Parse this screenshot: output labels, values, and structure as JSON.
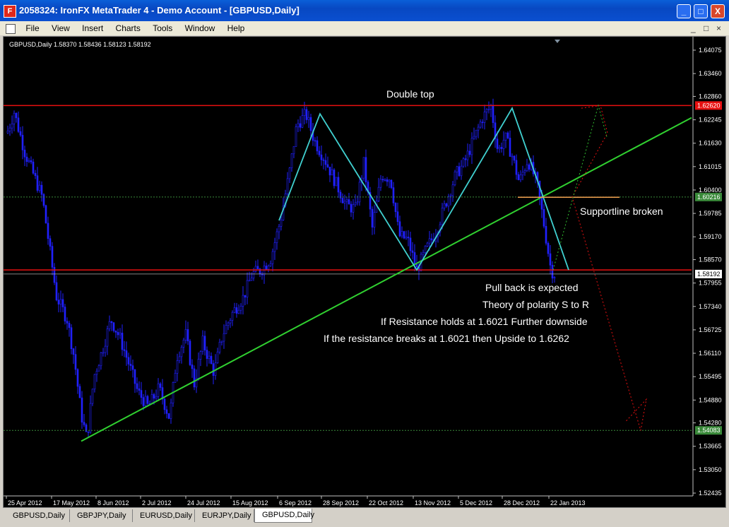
{
  "window": {
    "icon_letter": "F",
    "title": "2058324: IronFX MetaTrader 4 - Demo Account - [GBPUSD,Daily]",
    "minimize": "_",
    "maximize": "□",
    "close": "X"
  },
  "menu": [
    "File",
    "View",
    "Insert",
    "Charts",
    "Tools",
    "Window",
    "Help"
  ],
  "mdi_controls": [
    "_",
    "□",
    "×"
  ],
  "chart_header": "GBPUSD,Daily  1.58370 1.58436 1.58123 1.58192",
  "price_axis": {
    "labels": [
      "1.64075",
      "1.63460",
      "1.62860",
      "1.62245",
      "1.61630",
      "1.61015",
      "1.60400",
      "1.59785",
      "1.59170",
      "1.58570",
      "1.57955",
      "1.57340",
      "1.56725",
      "1.56110",
      "1.55495",
      "1.54880",
      "1.54280",
      "1.53665",
      "1.53050",
      "1.52435"
    ],
    "markers": [
      {
        "label": "1.62620",
        "value": 1.6262,
        "color": "#e81010"
      },
      {
        "label": "1.60216",
        "value": 1.60216,
        "color": "#3a8a3a"
      },
      {
        "label": "1.58192",
        "value": 1.58192,
        "color": "#ffffff"
      },
      {
        "label": "1.54083",
        "value": 1.54083,
        "color": "#3a8a3a"
      }
    ]
  },
  "date_axis": [
    "25 Apr 2012",
    "17 May 2012",
    "8 Jun 2012",
    "2 Jul 2012",
    "24 Jul 2012",
    "15 Aug 2012",
    "6 Sep 2012",
    "28 Sep 2012",
    "22 Oct 2012",
    "13 Nov 2012",
    "5 Dec 2012",
    "28 Dec 2012",
    "22 Jan 2013"
  ],
  "annotations": {
    "double_top": "Double top",
    "support_broken": "Supportline broken",
    "pullback": "Pull back is expected",
    "polarity": "Theory of polarity S to R",
    "resistance_holds": "If Resistance holds at 1.6021 Further downside",
    "resistance_breaks": "If the resistance breaks at 1.6021 then Upside to 1.6262"
  },
  "colors": {
    "candle": "#2020ff",
    "zigzag": "#40d0d0",
    "trendline": "#30d030",
    "resistance": "#e81010",
    "support_level": "#f0a050"
  },
  "tabs": [
    {
      "label": "GBPUSD,Daily",
      "active": false
    },
    {
      "label": "GBPJPY,Daily",
      "active": false
    },
    {
      "label": "EURUSD,Daily",
      "active": false
    },
    {
      "label": "EURJPY,Daily",
      "active": false
    },
    {
      "label": "GBPUSD,Daily",
      "active": true
    }
  ]
}
